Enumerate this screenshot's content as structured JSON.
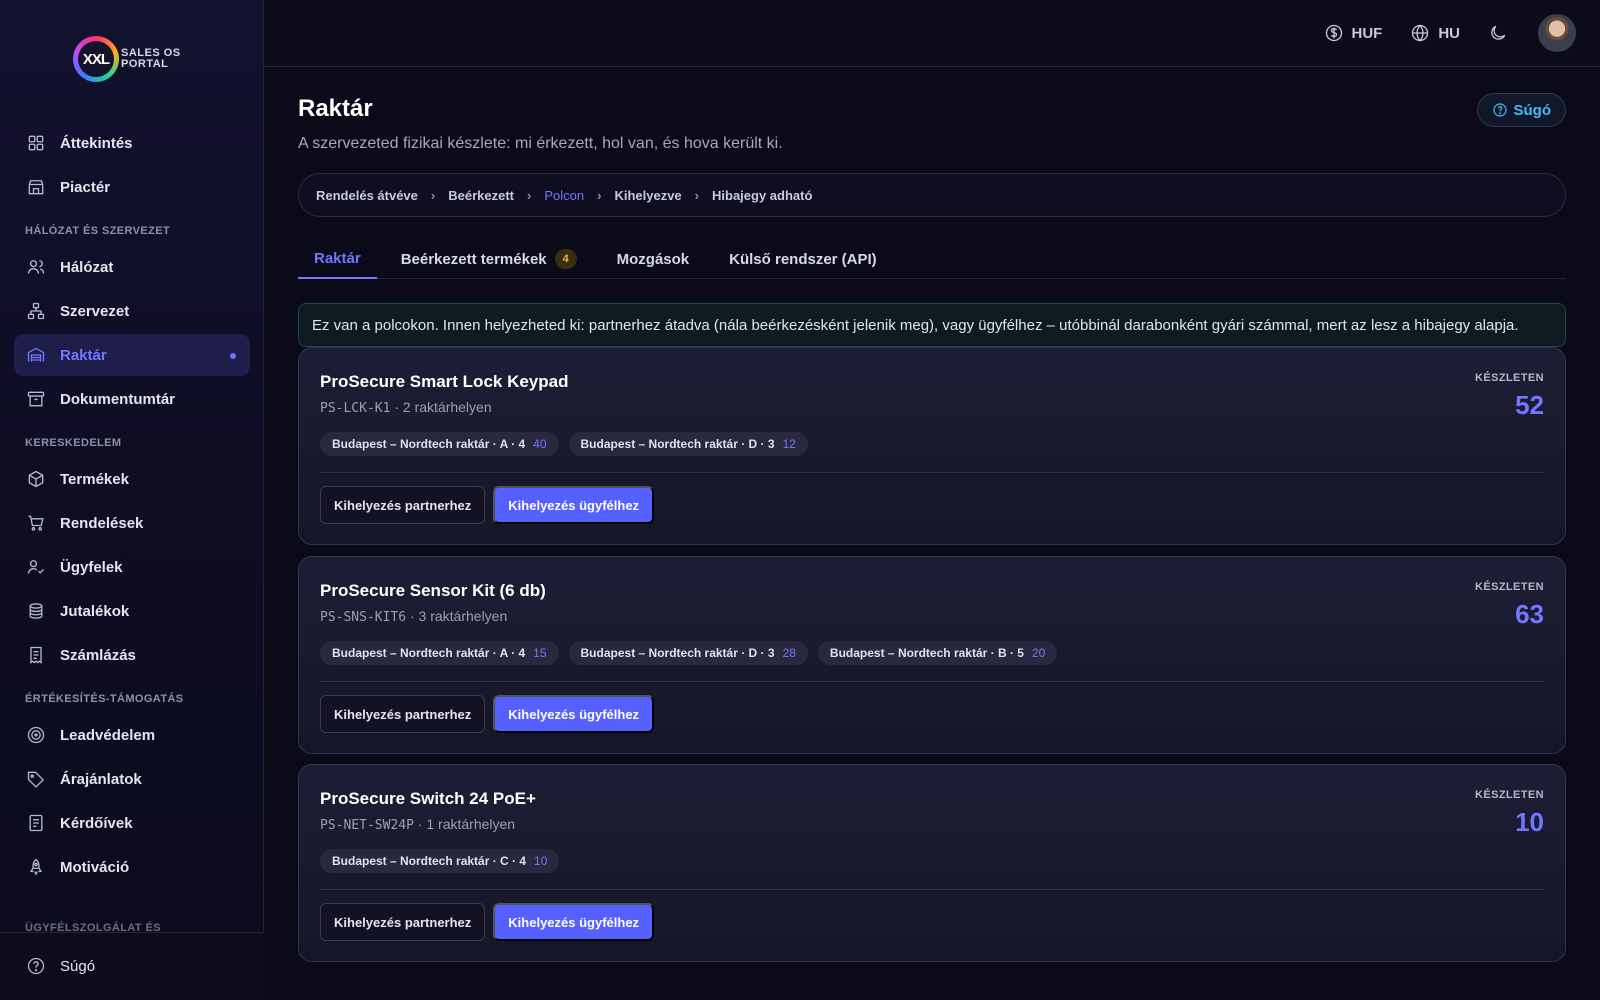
{
  "app": {
    "logo_mark": "XXL",
    "logo_text": "SALES OS PORTAL"
  },
  "sidebar": {
    "top_items": [
      {
        "label": "Áttekintés",
        "icon": "grid-icon"
      },
      {
        "label": "Piactér",
        "icon": "store-icon"
      }
    ],
    "sections": [
      {
        "title": "HÁLÓZAT ÉS SZERVEZET",
        "items": [
          {
            "label": "Hálózat",
            "icon": "users-icon"
          },
          {
            "label": "Szervezet",
            "icon": "org-chart-icon"
          },
          {
            "label": "Raktár",
            "icon": "warehouse-icon",
            "active": true
          },
          {
            "label": "Dokumentumtár",
            "icon": "archive-icon"
          }
        ]
      },
      {
        "title": "KERESKEDELEM",
        "items": [
          {
            "label": "Termékek",
            "icon": "box-icon"
          },
          {
            "label": "Rendelések",
            "icon": "cart-icon"
          },
          {
            "label": "Ügyfelek",
            "icon": "user-check-icon"
          },
          {
            "label": "Jutalékok",
            "icon": "coins-icon"
          },
          {
            "label": "Számlázás",
            "icon": "receipt-icon"
          }
        ]
      },
      {
        "title": "ÉRTÉKESÍTÉS-TÁMOGATÁS",
        "items": [
          {
            "label": "Leadvédelem",
            "icon": "target-icon"
          },
          {
            "label": "Árajánlatok",
            "icon": "tag-icon"
          },
          {
            "label": "Kérdőívek",
            "icon": "form-icon"
          },
          {
            "label": "Motiváció",
            "icon": "rocket-icon"
          }
        ]
      }
    ],
    "partial_section": "ÜGYFÉLSZOLGÁLAT ÉS",
    "bottom_item": {
      "label": "Súgó",
      "icon": "help-circle-icon"
    }
  },
  "topbar": {
    "currency": "HUF",
    "language": "HU",
    "theme_icon": "moon-icon",
    "avatar": "user-avatar"
  },
  "page": {
    "title": "Raktár",
    "subtitle": "A szervezeted fizikai készlete: mi érkezett, hol van, és hova került ki.",
    "help_label": "Súgó"
  },
  "breadcrumb": [
    {
      "label": "Rendelés átvéve"
    },
    {
      "label": "Beérkezett"
    },
    {
      "label": "Polcon",
      "active": true
    },
    {
      "label": "Kihelyezve"
    },
    {
      "label": "Hibajegy adható"
    }
  ],
  "tabs": [
    {
      "label": "Raktár",
      "active": true
    },
    {
      "label": "Beérkezett termékek",
      "badge": "4"
    },
    {
      "label": "Mozgások"
    },
    {
      "label": "Külső rendszer (API)"
    }
  ],
  "info_text": "Ez van a polcokon. Innen helyezheted ki: partnerhez átadva (nála beérkezésként jelenik meg), vagy ügyfélhez – utóbbinál darabonként gyári számmal, mert az lesz a hibajegy alapja.",
  "stock_label": "KÉSZLETEN",
  "actions": {
    "partner": "Kihelyezés partnerhez",
    "customer": "Kihelyezés ügyfélhez"
  },
  "products": [
    {
      "name": "ProSecure Smart Lock Keypad",
      "sku": "PS-LCK-K1",
      "locations_text": "· 2 raktárhelyen",
      "stock": "52",
      "chips": [
        {
          "label": "Budapest – Nordtech raktár · A · 4",
          "qty": "40"
        },
        {
          "label": "Budapest – Nordtech raktár · D · 3",
          "qty": "12"
        }
      ]
    },
    {
      "name": "ProSecure Sensor Kit (6 db)",
      "sku": "PS-SNS-KIT6",
      "locations_text": "· 3 raktárhelyen",
      "stock": "63",
      "chips": [
        {
          "label": "Budapest – Nordtech raktár · A · 4",
          "qty": "15"
        },
        {
          "label": "Budapest – Nordtech raktár · D · 3",
          "qty": "28"
        },
        {
          "label": "Budapest – Nordtech raktár · B · 5",
          "qty": "20"
        }
      ]
    },
    {
      "name": "ProSecure Switch 24 PoE+",
      "sku": "PS-NET-SW24P",
      "locations_text": "· 1 raktárhelyen",
      "stock": "10",
      "chips": [
        {
          "label": "Budapest – Nordtech raktár · C · 4",
          "qty": "10"
        }
      ]
    }
  ]
}
